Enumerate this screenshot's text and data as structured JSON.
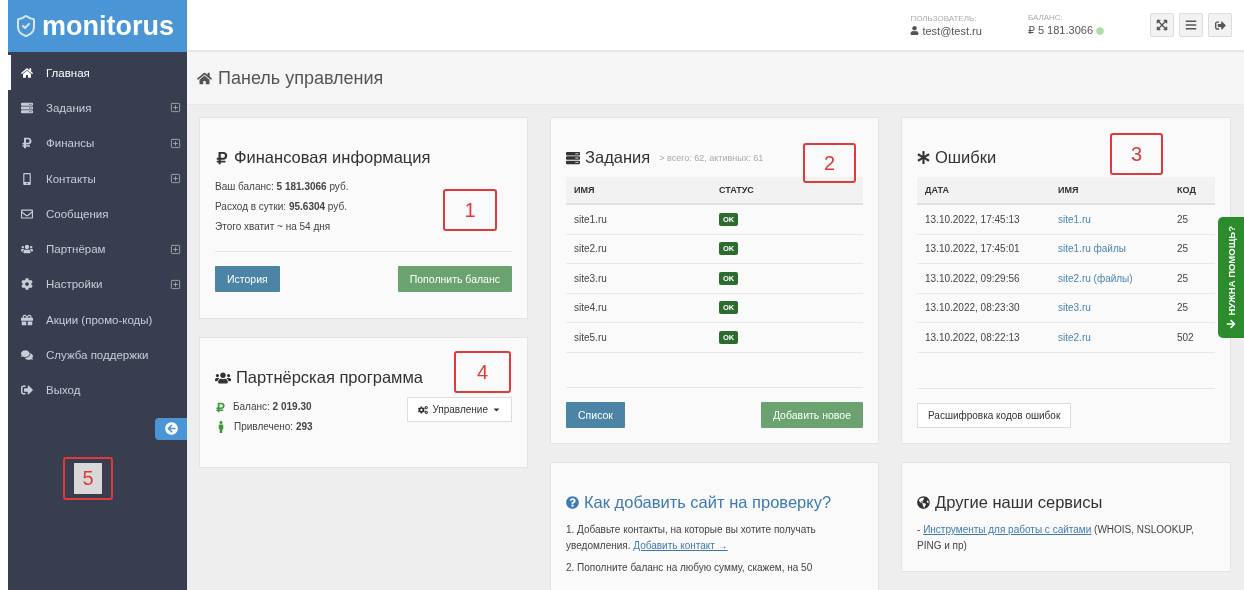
{
  "logo": {
    "text": "monitorus"
  },
  "header": {
    "user_label": "ПОЛЬЗОВАТЕЛЬ:",
    "user": "test@test.ru",
    "balance_label": "БАЛАНС:",
    "balance": "₽ 5 181.3066"
  },
  "sidebar": {
    "items": [
      {
        "label": "Главная",
        "selected": true,
        "expandable": false
      },
      {
        "label": "Задания",
        "selected": false,
        "expandable": true
      },
      {
        "label": "Финансы",
        "selected": false,
        "expandable": true
      },
      {
        "label": "Контакты",
        "selected": false,
        "expandable": true
      },
      {
        "label": "Сообщения",
        "selected": false,
        "expandable": false
      },
      {
        "label": "Партнёрам",
        "selected": false,
        "expandable": true
      },
      {
        "label": "Настройки",
        "selected": false,
        "expandable": true
      },
      {
        "label": "Акции (промо-коды)",
        "selected": false,
        "expandable": false
      },
      {
        "label": "Служба поддержки",
        "selected": false,
        "expandable": false
      },
      {
        "label": "Выход",
        "selected": false,
        "expandable": false
      }
    ]
  },
  "page_title": "Панель управления",
  "finance": {
    "title": "Финансовая информация",
    "lines": [
      "Ваш баланс: **5 181.3066** руб.",
      "Расход в сутки: **95.6304** руб.",
      "Этого хватит ~ на 54 дня"
    ],
    "buttons": [
      {
        "label": "История",
        "kind": "info"
      },
      {
        "label": "Пополнить баланс",
        "kind": "success"
      }
    ]
  },
  "partners": {
    "title": "Партнёрская программа",
    "lines": [
      "Баланс: **2 019.30**",
      "Привлечено: **293**"
    ],
    "menu_button": "Управление"
  },
  "tasks": {
    "title": "Задания",
    "subtitle": "> всего: 62, активных: 61",
    "columns": [
      "ИМЯ",
      "СТАТУС"
    ],
    "rows": [
      {
        "name": "site1.ru",
        "status": "OK"
      },
      {
        "name": "site2.ru",
        "status": "OK"
      },
      {
        "name": "site3.ru",
        "status": "OK"
      },
      {
        "name": "site4.ru",
        "status": "OK"
      },
      {
        "name": "site5.ru",
        "status": "OK"
      }
    ],
    "buttons": [
      {
        "label": "Список",
        "kind": "info"
      },
      {
        "label": "Добавить новое",
        "kind": "success"
      }
    ]
  },
  "errors": {
    "title": "Ошибки",
    "columns": [
      "ДАТА",
      "ИМЯ",
      "КОД"
    ],
    "rows": [
      {
        "date": "13.10.2022, 17:45:13",
        "name": "site1.ru",
        "code": "25"
      },
      {
        "date": "13.10.2022, 17:45:01",
        "name": "site1.ru файлы",
        "code": "25"
      },
      {
        "date": "13.10.2022, 09:29:56",
        "name": "site2.ru (файлы)",
        "code": "25"
      },
      {
        "date": "13.10.2022, 08:23:30",
        "name": "site3.ru",
        "code": "25"
      },
      {
        "date": "13.10.2022, 08:22:13",
        "name": "site2.ru",
        "code": "502"
      }
    ],
    "button": "Расшифровка кодов ошибок"
  },
  "howto": {
    "title": "Как добавить сайт на проверку?",
    "steps": [
      {
        "text": "1. Добавьте контакты, на которые вы хотите получать уведомления.",
        "link": "Добавить контакт →"
      },
      {
        "text": "2. Пополните баланс на любую сумму, скажем, на 50"
      }
    ]
  },
  "services": {
    "title": "Другие наши сервисы",
    "prefix": "-",
    "link": "Инструменты для работы с сайтами",
    "suffix": "(WHOIS, NSLOOKUP, PING и пр)"
  },
  "help_tab": {
    "label": "НУЖНА ПОМОЩЬ?"
  },
  "callouts": [
    {
      "label": "1"
    },
    {
      "label": "2"
    },
    {
      "label": "3"
    },
    {
      "label": "4"
    },
    {
      "label": "5"
    }
  ]
}
